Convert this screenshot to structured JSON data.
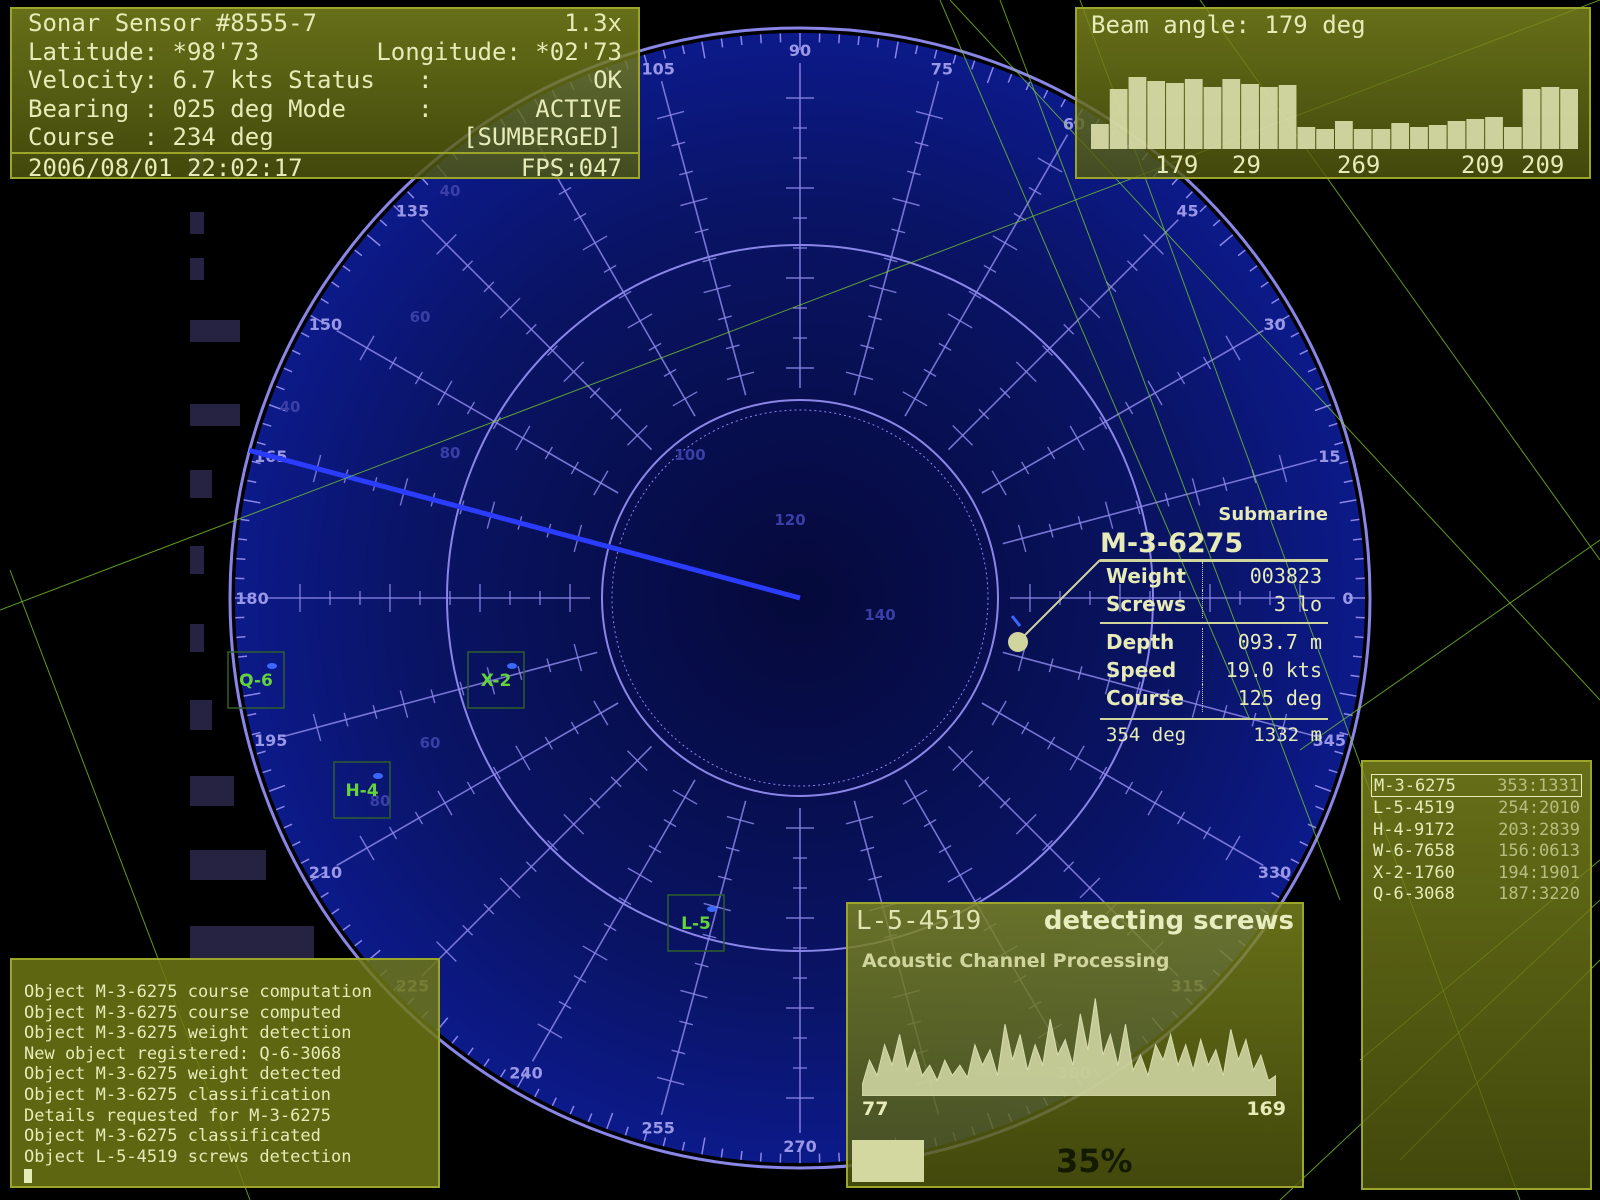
{
  "status": {
    "sensor": "Sonar Sensor #8555-7",
    "zoom": "1.3x",
    "latitude_label": "Latitude:",
    "latitude_value": "*98'73",
    "longitude_label": "Longitude:",
    "longitude_value": "*02'73",
    "velocity_label": "Velocity:",
    "velocity_value": "6.7 kts",
    "status_label": "Status   :",
    "status_value": "OK",
    "bearing_label": "Bearing :",
    "bearing_value": "025 deg",
    "mode_label": "Mode     :",
    "mode_value": "ACTIVE",
    "course_label": "Course  :",
    "course_value": "234 deg",
    "depth_state": "[SUMBERGED]",
    "datetime": "2006/08/01 22:02:17",
    "fps": "FPS:047"
  },
  "beam": {
    "title": "Beam angle: 179 deg",
    "ticks": [
      "179",
      "29",
      "269",
      "209",
      "209"
    ],
    "levels": [
      0.25,
      0.6,
      0.72,
      0.68,
      0.66,
      0.7,
      0.62,
      0.7,
      0.65,
      0.62,
      0.64,
      0.22,
      0.2,
      0.28,
      0.2,
      0.2,
      0.26,
      0.22,
      0.24,
      0.28,
      0.3,
      0.32,
      0.22,
      0.6,
      0.62,
      0.6
    ]
  },
  "radar": {
    "bearing_labels": [
      "0",
      "15",
      "30",
      "45",
      "60",
      "75",
      "90",
      "105",
      "135",
      "150",
      "165",
      "180",
      "195",
      "210",
      "225",
      "240",
      "255",
      "270",
      "300",
      "315",
      "330",
      "345"
    ],
    "depth_labels": [
      "40",
      "60",
      "80",
      "100",
      "120",
      "140",
      "40",
      "60",
      "80"
    ],
    "sweep_bearing": 165,
    "colors": {
      "ring": "#8a86e8",
      "sweep": "#2a3cff",
      "contact": "#63d43a",
      "overlay": "#7fcd2a"
    }
  },
  "contacts_on_map": [
    {
      "id": "Q-6"
    },
    {
      "id": "X-2"
    },
    {
      "id": "H-4"
    },
    {
      "id": "L-5"
    }
  ],
  "target": {
    "class": "Submarine",
    "name": "M-3-6275",
    "weight_label": "Weight",
    "weight": "003823",
    "screws_label": "Screws",
    "screws": "3 lo",
    "depth_label": "Depth",
    "depth": "093.7 m",
    "speed_label": "Speed",
    "speed": "19.0 kts",
    "course_label": "Course",
    "course": "125 deg",
    "bearing": "354 deg",
    "range": "1332 m"
  },
  "acoustic": {
    "id": "L-5-4519",
    "state": "detecting screws",
    "title": "Acoustic Channel Processing",
    "min": "77",
    "max": "169",
    "progress_label": "35%",
    "progress": 0.35,
    "signal": [
      0.1,
      0.35,
      0.2,
      0.5,
      0.3,
      0.6,
      0.25,
      0.45,
      0.2,
      0.3,
      0.15,
      0.35,
      0.2,
      0.3,
      0.18,
      0.5,
      0.3,
      0.45,
      0.2,
      0.7,
      0.35,
      0.6,
      0.25,
      0.5,
      0.3,
      0.75,
      0.4,
      0.55,
      0.3,
      0.8,
      0.45,
      0.95,
      0.4,
      0.6,
      0.3,
      0.7,
      0.25,
      0.4,
      0.2,
      0.5,
      0.35,
      0.6,
      0.3,
      0.5,
      0.25,
      0.55,
      0.3,
      0.45,
      0.2,
      0.65,
      0.35,
      0.55,
      0.25,
      0.4,
      0.15,
      0.2
    ]
  },
  "contact_list": [
    {
      "id": "M-3-6275",
      "value": "353:1331"
    },
    {
      "id": "L-5-4519",
      "value": "254:2010"
    },
    {
      "id": "H-4-9172",
      "value": "203:2839"
    },
    {
      "id": "W-6-7658",
      "value": "156:0613"
    },
    {
      "id": "X-2-1760",
      "value": "194:1901"
    },
    {
      "id": "Q-6-3068",
      "value": "187:3220"
    }
  ],
  "log": [
    "Object M-3-6275 course computation",
    "Object M-3-6275 course computed",
    "Object M-3-6275 weight detection",
    "New object registered: Q-6-3068",
    "Object M-3-6275 weight detected",
    "Object M-3-6275 classification",
    "Details requested for M-3-6275",
    "Object M-3-6275 classificated",
    "Object L-5-4519 screws detection"
  ]
}
